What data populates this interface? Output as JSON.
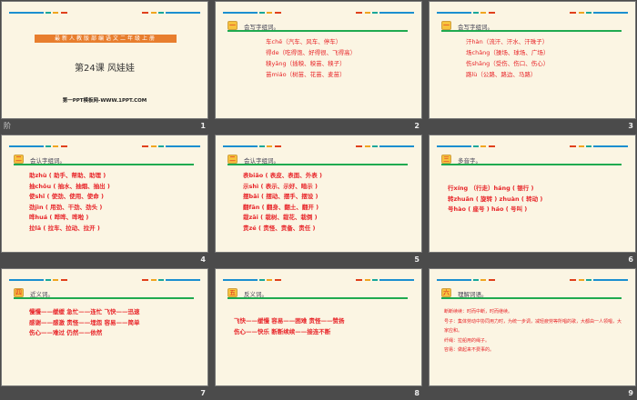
{
  "colors": {
    "red": "#e8262a",
    "green": "#1faa50",
    "blue": "#1b8fd0",
    "orange": "#e87e2e",
    "cream": "#fbf5e3"
  },
  "status_icon": "阶",
  "slides": [
    {
      "num": "1",
      "banner": "最新人教版部编语文二年级上册",
      "title": "第24课  风娃娃",
      "subtitle": "第一PPT模板网-WWW.1PPT.COM"
    },
    {
      "num": "2",
      "badge": "一",
      "heading": "会写字组词。",
      "lines": [
        "车chē（汽车、风车、停车）",
        "得de（吃得饱、好得很、飞得高）",
        "秧yāng（插秧、秧苗、秧子）",
        "苗miáo（树苗、花苗、麦苗）"
      ]
    },
    {
      "num": "3",
      "badge": "一",
      "heading": "会写字组词。",
      "lines": [
        "汗hàn（流汗、汗水、汗珠子）",
        "场chǎng（操场、球场、广场）",
        "伤shāng（受伤、伤口、伤心）",
        "路lù（公路、路边、马路）"
      ]
    },
    {
      "num": "4",
      "badge": "二",
      "heading": "会认字组词。",
      "lines": [
        "助zhù ( 助手、帮助、助理 )",
        "抽chōu ( 抽水、抽烟、抽出 )",
        "使shǐ ( 使劲、使用、使命 )",
        "劲jìn ( 用劲、干劲、劲头 )",
        "哗huá ( 哗哗、哗啦 )",
        "拉lā ( 拉车、拉动、拉开 )"
      ]
    },
    {
      "num": "5",
      "badge": "二",
      "heading": "会认字组词。",
      "lines": [
        "表biǎo ( 表皮、表面、外表 )",
        "示shì ( 表示、示好、暗示 )",
        "摆bǎi ( 摆动、摆手、摆设 )",
        "翻fān ( 翻身、翻土、翻开 )",
        "栽zāi ( 栽树、栽花、栽倒 )",
        "责zé ( 责怪、责备、责任 )"
      ]
    },
    {
      "num": "6",
      "badge": "三",
      "heading": "多音字。",
      "lines": [
        "行xíng （行走）háng ( 银行 )",
        "转zhuǎn ( 旋转 ) zhuàn ( 转动 )",
        "号hào ( 座号 ) háo ( 号叫 )"
      ]
    },
    {
      "num": "7",
      "badge": "四",
      "heading": "近义词。",
      "lines": [
        "慢慢——缓缓 急忙——连忙 飞快——迅速",
        "感谢——感激 责怪——埋怨 容易——简单",
        "伤心——难过 仍然——依然"
      ]
    },
    {
      "num": "8",
      "badge": "五",
      "heading": "反义词。",
      "lines": [
        "飞快——缓慢 容易——困难 责怪——赞扬",
        "伤心——快乐 断断续续——接连不断"
      ]
    },
    {
      "num": "9",
      "badge": "六",
      "heading": "理解词语。",
      "lines": [
        "断断续续：时而中断，时而继续。",
        "号子：集体劳动中协同用力时，为统一步调，减轻疲劳等所唱的歌，大都由一人领唱，大家应和。",
        "纤绳：拉船用的绳子。",
        "容易：做起来不费事的。"
      ]
    }
  ]
}
